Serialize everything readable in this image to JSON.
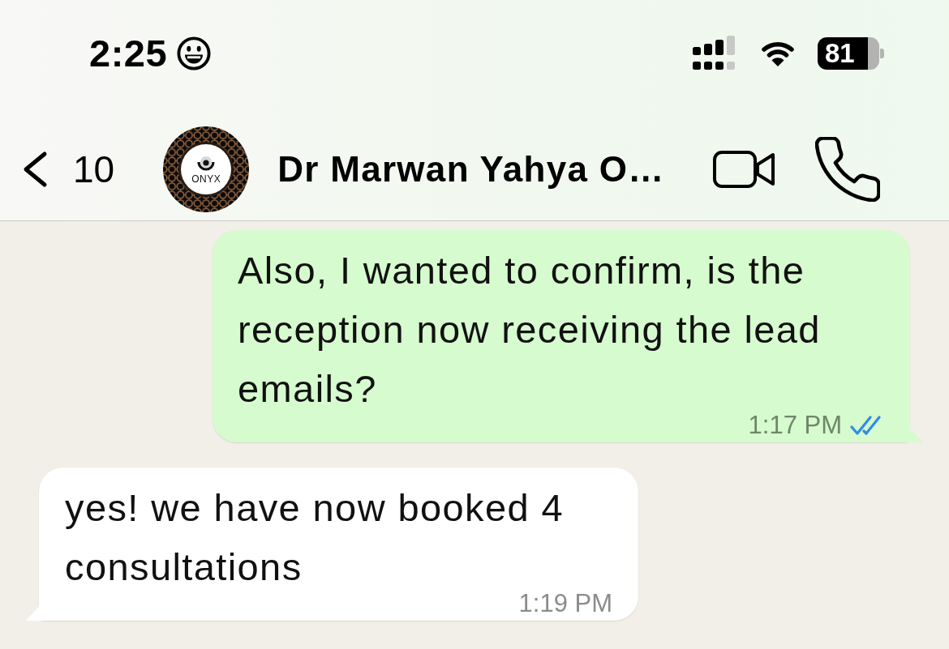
{
  "status_bar": {
    "time": "2:25",
    "battery": "81"
  },
  "header": {
    "back_count": "10",
    "avatar_text": "ONYX",
    "contact_name": "Dr Marwan Yahya O…"
  },
  "messages": [
    {
      "kind": "sent",
      "text": "Also, I wanted to confirm, is the reception now receiving the lead emails?",
      "time": "1:17 PM",
      "read": true
    },
    {
      "kind": "received",
      "text": "yes! we have now booked 4 consultations",
      "time": "1:19 PM"
    }
  ]
}
